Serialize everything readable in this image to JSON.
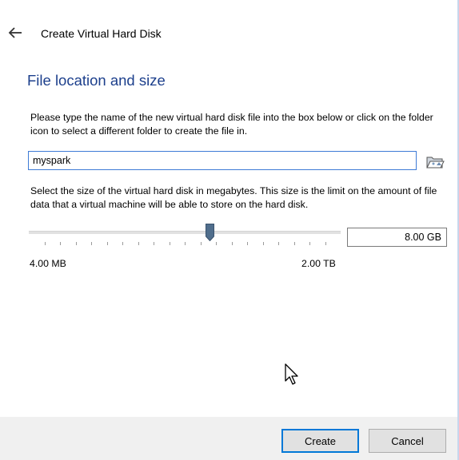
{
  "dialog": {
    "title": "Create Virtual Hard Disk",
    "heading": "File location and size",
    "file_description": "Please type the name of the new virtual hard disk file into the box below or click on the folder icon to select a different folder to create the file in.",
    "file_name_value": "myspark",
    "size_description": "Select the size of the virtual hard disk in megabytes. This size is the limit on the amount of file data that a virtual machine will be able to store on the hard disk.",
    "size_value": "8.00 GB",
    "slider": {
      "min_label": "4.00 MB",
      "max_label": "2.00 TB",
      "position_fraction": 0.58,
      "tick_count": 20
    },
    "buttons": {
      "create": "Create",
      "cancel": "Cancel"
    },
    "icons": {
      "back": "back-arrow-icon",
      "folder": "folder-icon",
      "cursor": "mouse-cursor-icon"
    },
    "colors": {
      "heading": "#1c3f8c",
      "accent": "#0078d7",
      "handle": "#506e8c",
      "footer_bg": "#f0f0f0"
    }
  }
}
